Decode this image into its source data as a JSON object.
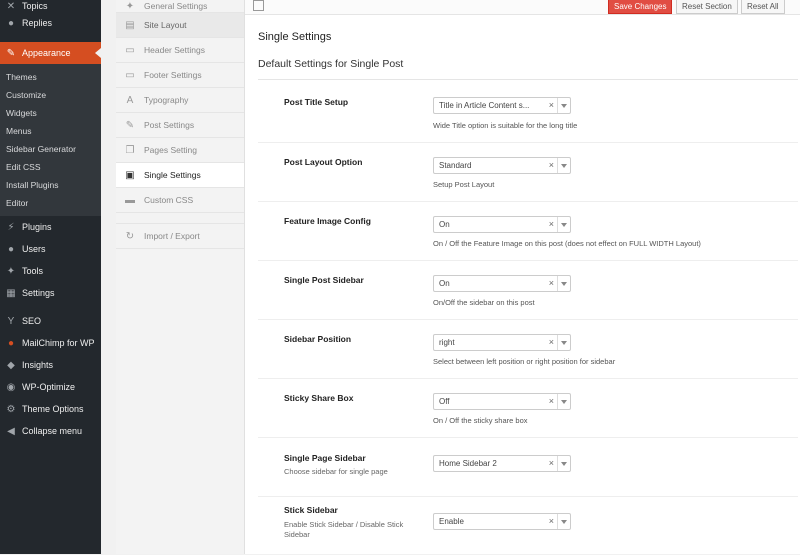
{
  "admin_menu": {
    "items_top": [
      {
        "label": "Topics",
        "icon": "topics-icon"
      },
      {
        "label": "Replies",
        "icon": "replies-icon"
      }
    ],
    "appearance": {
      "label": "Appearance",
      "icon": "paintbrush-icon"
    },
    "appearance_sub": [
      "Themes",
      "Customize",
      "Widgets",
      "Menus",
      "Sidebar Generator",
      "Edit CSS",
      "Install Plugins",
      "Editor"
    ],
    "items_mid": [
      {
        "label": "Plugins",
        "icon": "plugin-icon"
      },
      {
        "label": "Users",
        "icon": "users-icon"
      },
      {
        "label": "Tools",
        "icon": "wrench-icon"
      },
      {
        "label": "Settings",
        "icon": "settings-icon"
      }
    ],
    "items_bottom": [
      {
        "label": "SEO",
        "icon": "seo-icon"
      },
      {
        "label": "MailChimp for WP",
        "icon": "mailchimp-icon"
      },
      {
        "label": "Insights",
        "icon": "insights-icon"
      },
      {
        "label": "WP-Optimize",
        "icon": "optimize-icon"
      },
      {
        "label": "Theme Options",
        "icon": "theme-options-icon"
      },
      {
        "label": "Collapse menu",
        "icon": "collapse-icon"
      }
    ]
  },
  "options_nav": [
    {
      "label": "General Settings",
      "icon": "wrench-icon"
    },
    {
      "label": "Site Layout",
      "icon": "layout-icon"
    },
    {
      "label": "Header Settings",
      "icon": "header-icon"
    },
    {
      "label": "Footer Settings",
      "icon": "footer-icon"
    },
    {
      "label": "Typography",
      "icon": "typography-icon"
    },
    {
      "label": "Post Settings",
      "icon": "edit-icon"
    },
    {
      "label": "Pages Setting",
      "icon": "pages-icon"
    },
    {
      "label": "Single Settings",
      "icon": "clipboard-icon"
    },
    {
      "label": "Custom CSS",
      "icon": "css-icon"
    },
    {
      "label": "Import / Export",
      "icon": "refresh-icon"
    }
  ],
  "toolbar": {
    "save": "Save Changes",
    "reset_section": "Reset Section",
    "reset_all": "Reset All"
  },
  "section_title": "Single Settings",
  "section_subtitle": "Default Settings for Single Post",
  "fields": [
    {
      "label": "Post Title Setup",
      "desc": "",
      "value": "Title in Article Content s...",
      "help": "Wide Title option is suitable for the long title"
    },
    {
      "label": "Post Layout Option",
      "desc": "",
      "value": "Standard",
      "help": "Setup Post Layout"
    },
    {
      "label": "Feature Image Config",
      "desc": "",
      "value": "On",
      "help": "On / Off the Feature Image on this post (does not effect on FULL WIDTH Layout)"
    },
    {
      "label": "Single Post Sidebar",
      "desc": "",
      "value": "On",
      "help": "On/Off the sidebar on this post"
    },
    {
      "label": "Sidebar Position",
      "desc": "",
      "value": "right",
      "help": "Select between left position or right position for sidebar"
    },
    {
      "label": "Sticky Share Box",
      "desc": "",
      "value": "Off",
      "help": "On / Off the sticky share box"
    },
    {
      "label": "Single Page Sidebar",
      "desc": "Choose sidebar for single page",
      "value": "Home Sidebar 2",
      "help": ""
    },
    {
      "label": "Stick Sidebar",
      "desc": "Enable Stick Sidebar / Disable Stick Sidebar",
      "value": "Enable",
      "help": ""
    }
  ]
}
